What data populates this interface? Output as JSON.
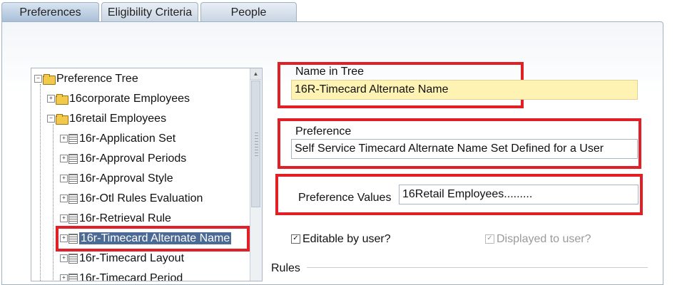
{
  "tabs": [
    {
      "label": "Preferences",
      "active": true
    },
    {
      "label": "Eligibility Criteria",
      "active": false
    },
    {
      "label": "People",
      "active": false
    }
  ],
  "tree": {
    "root": "Preference Tree",
    "groups": [
      "16corporate Employees",
      "16retail Employees"
    ],
    "items": [
      "16r-Application Set",
      "16r-Approval Periods",
      "16r-Approval Style",
      "16r-Otl Rules Evaluation",
      "16r-Retrieval Rule",
      "16r-Timecard Alternate Name",
      "16r-Timecard Layout",
      "16r-Timecard Period"
    ],
    "selected": "16r-Timecard Alternate Name"
  },
  "form": {
    "name_in_tree_label": "Name in Tree",
    "name_in_tree_value": "16R-Timecard Alternate Name",
    "preference_label": "Preference",
    "preference_value": "Self Service Timecard Alternate Name Set Defined for a User",
    "preference_values_label": "Preference Values",
    "preference_values_value": "16Retail Employees.........",
    "editable_label": "Editable by user?",
    "editable_checked": true,
    "displayed_label": "Displayed to user?",
    "displayed_checked": true,
    "rules_label": "Rules"
  },
  "colors": {
    "highlight_border": "#e01f26",
    "readonly_field": "#fff3b3",
    "selection": "#4b6a95"
  }
}
